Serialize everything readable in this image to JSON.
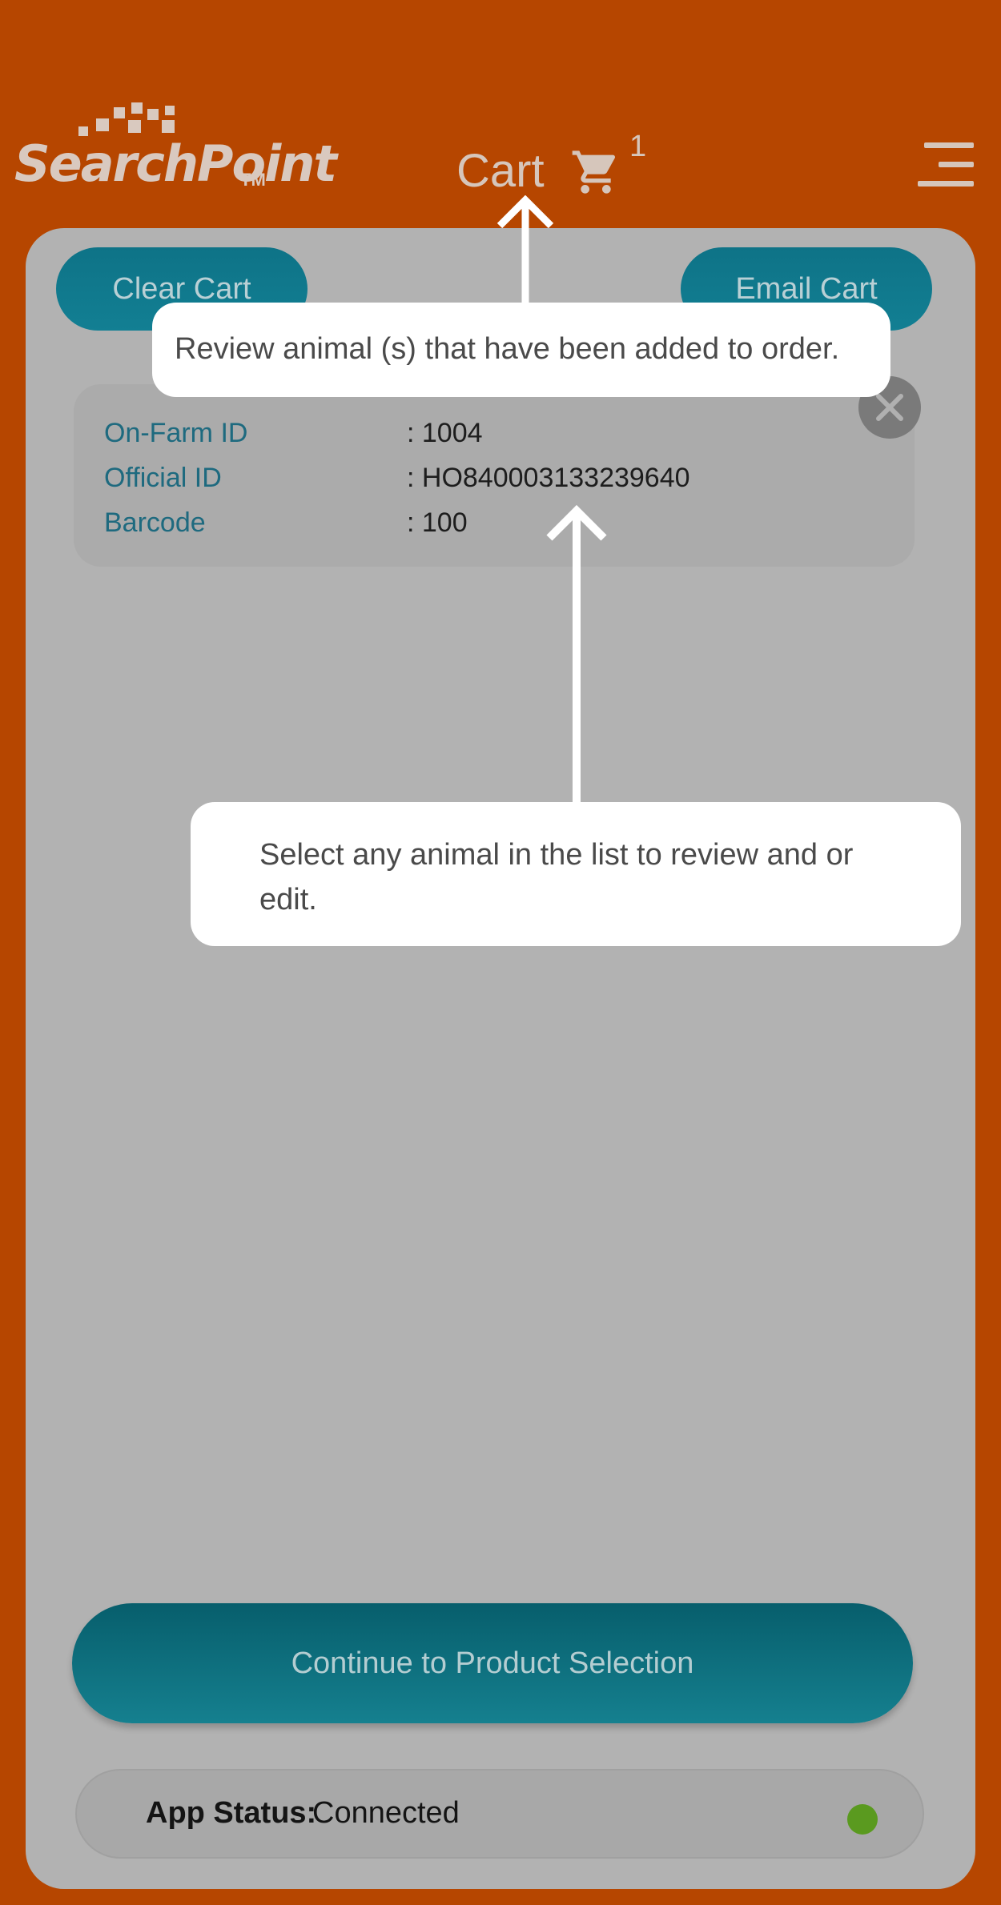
{
  "header": {
    "logo_text": "SearchPoint",
    "logo_tm": "TM",
    "title": "Cart",
    "cart_icon": "shopping-cart-icon",
    "cart_count": "1",
    "menu_icon": "hamburger-menu-icon"
  },
  "actions": {
    "clear_label": "Clear Cart",
    "email_label": "Email Cart"
  },
  "cart_items": [
    {
      "rows": [
        {
          "label": "On-Farm ID",
          "value": ": 1004"
        },
        {
          "label": "Official ID",
          "value": ": HO840003133239640"
        },
        {
          "label": "Barcode",
          "value": ": 100"
        }
      ]
    }
  ],
  "continue_label": "Continue to Product Selection",
  "status": {
    "label": "App Status:",
    "value": "Connected",
    "indicator_color": "#5a9a1f"
  },
  "tooltips": {
    "cart_tip": "Review animal (s) that have been added to order.",
    "list_tip": "Select any animal in the list to review and or edit."
  },
  "colors": {
    "background": "#b64600",
    "panel": "#b2b2b2",
    "accent": "#0e7387"
  }
}
